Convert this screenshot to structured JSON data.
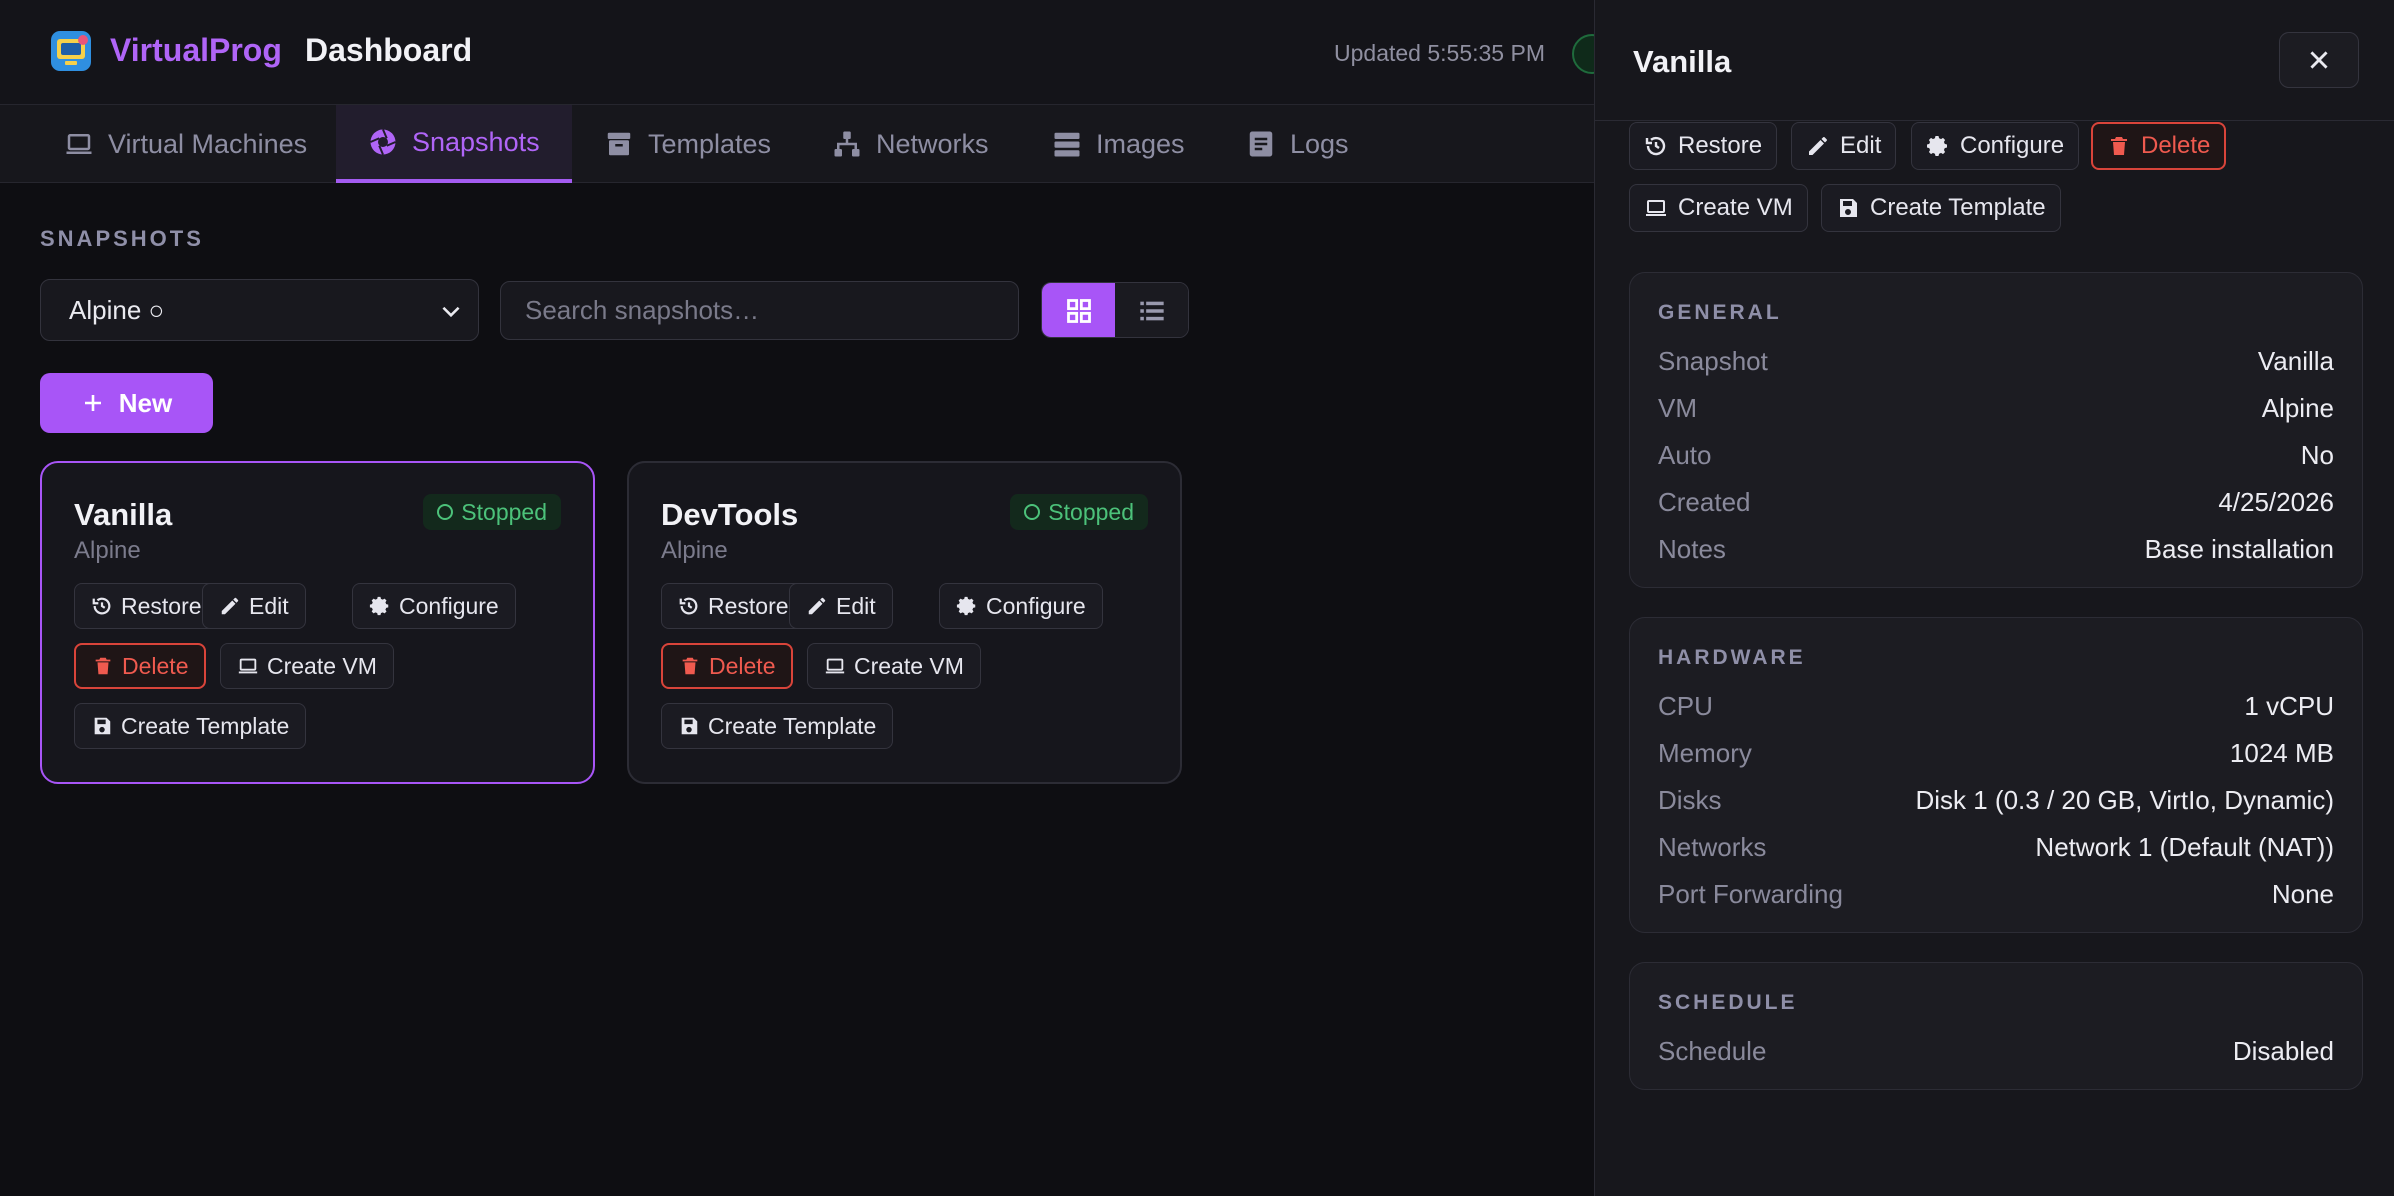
{
  "header": {
    "brand": "VirtualProg",
    "title": "Dashboard",
    "updated": "Updated 5:55:35 PM"
  },
  "tabs": [
    {
      "label": "Virtual Machines",
      "icon": "laptop-icon",
      "active": false
    },
    {
      "label": "Snapshots",
      "icon": "aperture-icon",
      "active": true
    },
    {
      "label": "Templates",
      "icon": "archive-icon",
      "active": false
    },
    {
      "label": "Networks",
      "icon": "network-icon",
      "active": false
    },
    {
      "label": "Images",
      "icon": "server-icon",
      "active": false
    },
    {
      "label": "Logs",
      "icon": "log-icon",
      "active": false
    }
  ],
  "main": {
    "section_label": "SNAPSHOTS",
    "vm_select": "Alpine ○",
    "search_placeholder": "Search snapshots…",
    "new_label": "New",
    "cards": [
      {
        "name": "Vanilla",
        "vm": "Alpine",
        "status": "Stopped",
        "selected": true,
        "actions": {
          "restore": "Restore",
          "edit": "Edit",
          "configure": "Configure",
          "delete": "Delete",
          "create_vm": "Create VM",
          "create_template": "Create Template"
        }
      },
      {
        "name": "DevTools",
        "vm": "Alpine",
        "status": "Stopped",
        "selected": false,
        "actions": {
          "restore": "Restore",
          "edit": "Edit",
          "configure": "Configure",
          "delete": "Delete",
          "create_vm": "Create VM",
          "create_template": "Create Template"
        }
      }
    ]
  },
  "panel": {
    "title": "Vanilla",
    "actions": {
      "restore": "Restore",
      "edit": "Edit",
      "configure": "Configure",
      "delete": "Delete",
      "create_vm": "Create VM",
      "create_template": "Create Template"
    },
    "general": {
      "title": "GENERAL",
      "rows": [
        {
          "k": "Snapshot",
          "v": "Vanilla"
        },
        {
          "k": "VM",
          "v": "Alpine"
        },
        {
          "k": "Auto",
          "v": "No"
        },
        {
          "k": "Created",
          "v": "4/25/2026"
        },
        {
          "k": "Notes",
          "v": "Base installation"
        }
      ]
    },
    "hardware": {
      "title": "HARDWARE",
      "rows": [
        {
          "k": "CPU",
          "v": "1 vCPU"
        },
        {
          "k": "Memory",
          "v": "1024 MB"
        },
        {
          "k": "Disks",
          "v": "Disk 1 (0.3 / 20 GB, VirtIo, Dynamic)"
        },
        {
          "k": "Networks",
          "v": "Network 1 (Default (NAT))"
        },
        {
          "k": "Port Forwarding",
          "v": "None"
        }
      ]
    },
    "schedule": {
      "title": "SCHEDULE",
      "rows": [
        {
          "k": "Schedule",
          "v": "Disabled"
        }
      ]
    }
  },
  "colors": {
    "accent": "#a855f7",
    "danger": "#ef5a4f",
    "success": "#4cc27a",
    "background": "#0e0e12"
  }
}
